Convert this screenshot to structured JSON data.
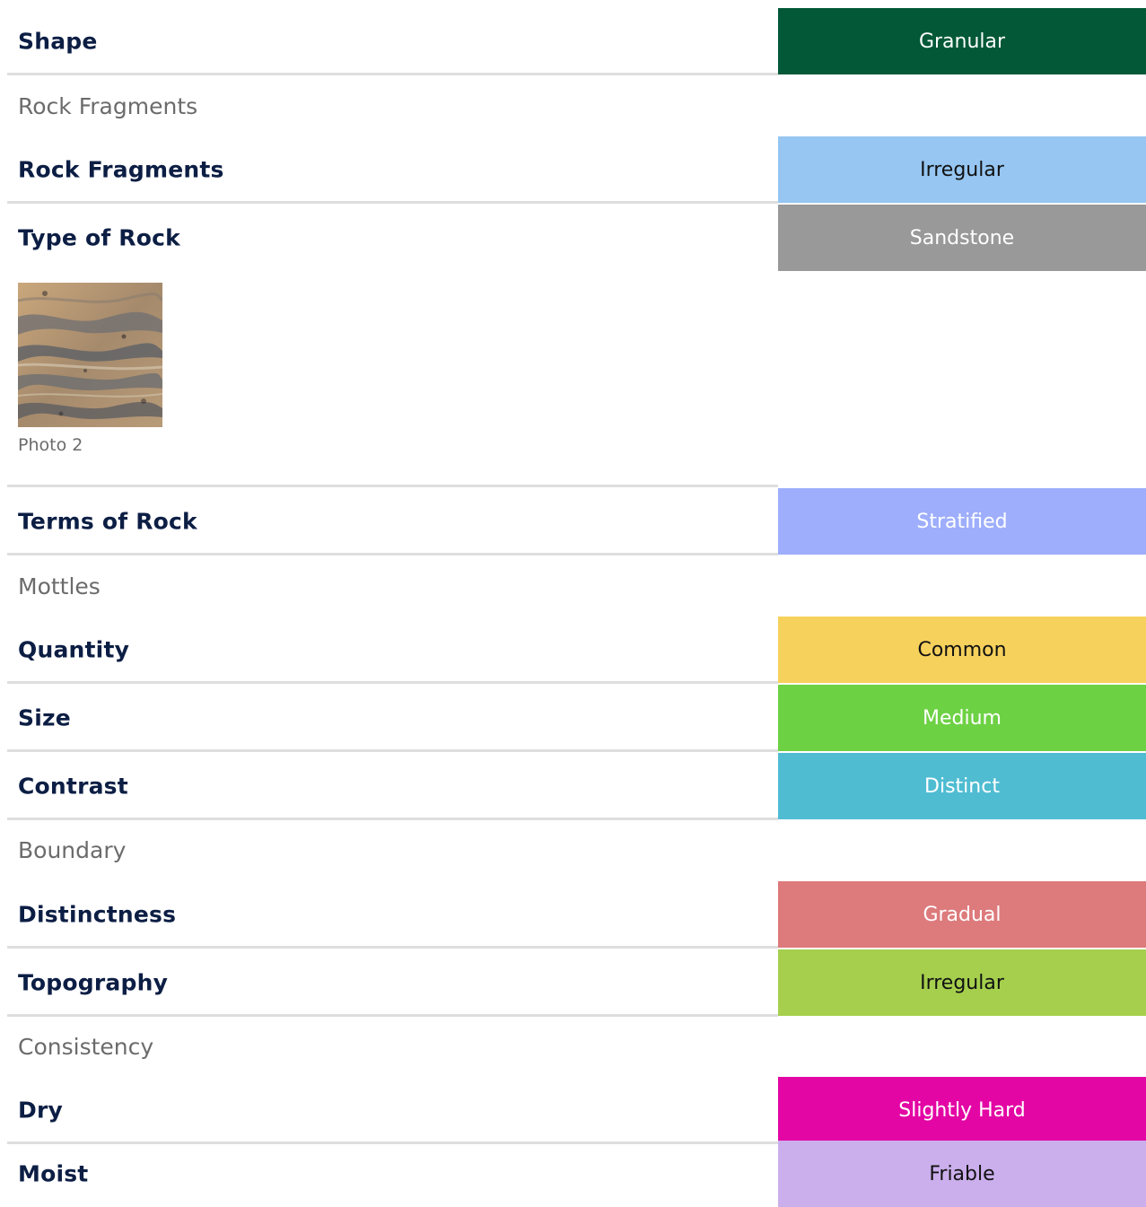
{
  "sections": {
    "rock_fragments": "Rock Fragments",
    "mottles": "Mottles",
    "boundary": "Boundary",
    "consistency": "Consistency"
  },
  "rows": {
    "shape": {
      "label": "Shape",
      "value": "Granular",
      "bg": "#025837",
      "fg": "#ffffff"
    },
    "rock_fragments": {
      "label": "Rock Fragments",
      "value": "Irregular",
      "bg": "#96c6f1",
      "fg": "#111111"
    },
    "type_of_rock": {
      "label": "Type of Rock",
      "value": "Sandstone",
      "bg": "#999999",
      "fg": "#ffffff"
    },
    "terms_of_rock": {
      "label": "Terms of Rock",
      "value": "Stratified",
      "bg": "#9eaefc",
      "fg": "#ffffff"
    },
    "quantity": {
      "label": "Quantity",
      "value": "Common",
      "bg": "#f6d15c",
      "fg": "#111111"
    },
    "size": {
      "label": "Size",
      "value": "Medium",
      "bg": "#6dd144",
      "fg": "#ffffff"
    },
    "contrast": {
      "label": "Contrast",
      "value": "Distinct",
      "bg": "#4fbcd2",
      "fg": "#ffffff"
    },
    "distinctness": {
      "label": "Distinctness",
      "value": "Gradual",
      "bg": "#dd7a7c",
      "fg": "#ffffff"
    },
    "topography": {
      "label": "Topography",
      "value": "Irregular",
      "bg": "#a5cf4d",
      "fg": "#111111"
    },
    "dry": {
      "label": "Dry",
      "value": "Slightly Hard",
      "bg": "#e305a4",
      "fg": "#ffffff"
    },
    "moist": {
      "label": "Moist",
      "value": "Friable",
      "bg": "#cbafec",
      "fg": "#111111"
    }
  },
  "photo": {
    "caption": "Photo 2",
    "icon": "rock-photo-thumbnail"
  }
}
